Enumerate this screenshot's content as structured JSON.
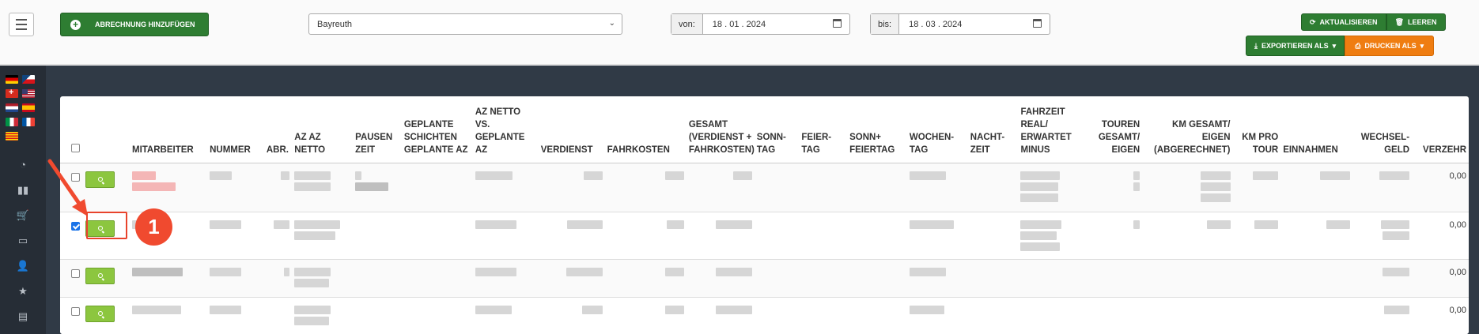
{
  "topbar": {
    "add_button_label": "ABRECHNUNG HINZUFÜGEN",
    "location_select_value": "Bayreuth",
    "from_label": "von:",
    "from_date": "18 . 01 . 2024",
    "to_label": "bis:",
    "to_date": "18 . 03 . 2024",
    "refresh_label": "AKTUALISIEREN",
    "clear_label": "LEEREN",
    "export_label": "EXPORTIEREN ALS",
    "print_label": "DRUCKEN ALS"
  },
  "sidebar": {
    "languages": [
      "de",
      "cz",
      "ch",
      "us",
      "nl",
      "es",
      "it",
      "fr",
      "cat"
    ],
    "icons": [
      "dashboard-icon",
      "chart-icon",
      "cart-icon",
      "monitor-icon",
      "add-user-icon",
      "star-icon",
      "archive-icon"
    ]
  },
  "table": {
    "headers": {
      "mitarbeiter": "MITARBEITER",
      "nummer": "NUMMER",
      "abr": "ABR.",
      "az_netto": "AZ AZ NETTO",
      "pausen": "PAUSEN ZEIT",
      "geplante": "GEPLANTE SCHICHTEN GEPLANTE AZ",
      "az_vs": "AZ NETTO VS. GEPLANTE AZ",
      "verdienst": "VERDIENST",
      "fahrkosten": "FAHRKOSTEN",
      "gesamt": "GESAMT (VERDIENST + FAHRKOSTEN)",
      "sonntag": "SONN- TAG",
      "feiertag": "FEIER- TAG",
      "sonnfeier": "SONN+ FEIERTAG",
      "wochentag": "WOCHEN- TAG",
      "nachtzeit": "NACHT- ZEIT",
      "fahrzeit": "FAHRZEIT REAL/ ERWARTET MINUS",
      "touren": "TOUREN GESAMT/ EIGEN",
      "km_gesamt": "KM GESAMT/ EIGEN (ABGERECHNET)",
      "km_pro_tour": "KM PRO TOUR",
      "einnahmen": "EINNAHMEN",
      "wechselgeld": "WECHSEL- GELD",
      "verzehr": "VERZEHR"
    },
    "rows": [
      {
        "checked": false,
        "verzehr": "0,00"
      },
      {
        "checked": true,
        "verzehr": "0,00"
      },
      {
        "checked": false,
        "verzehr": "0,00"
      },
      {
        "checked": false,
        "verzehr": "0,00"
      }
    ]
  },
  "annotation": {
    "badge": "1",
    "color": "#f04a2f"
  }
}
